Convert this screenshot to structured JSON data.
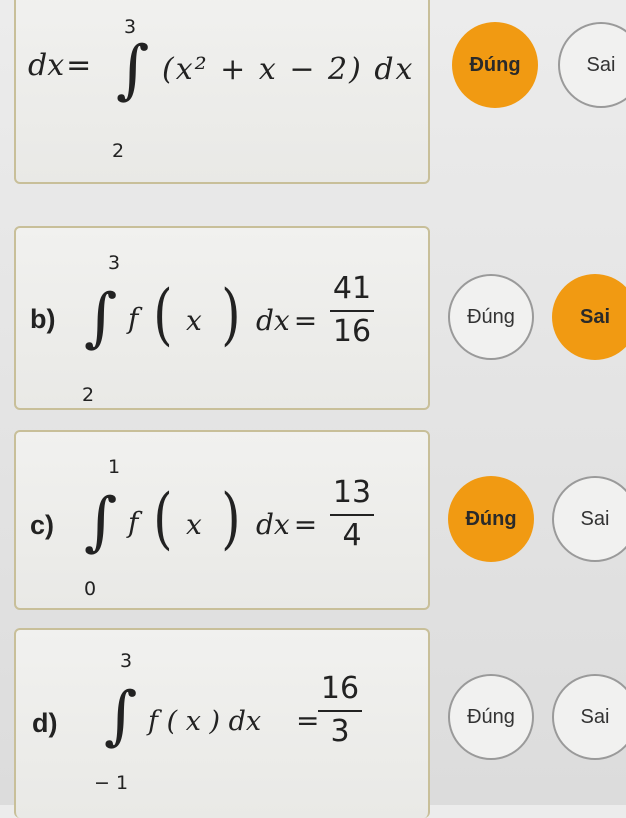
{
  "questions": [
    {
      "id": "a",
      "label": "",
      "lower": "2",
      "upper": "3",
      "lhs": "dx",
      "eq": "=",
      "integrand": "(x² + x − 2) dx",
      "choices": {
        "true_label": "Đúng",
        "false_label": "Sai",
        "selected": "true"
      }
    },
    {
      "id": "b",
      "label": "b)",
      "lower": "2",
      "upper": "3",
      "f": "f",
      "x": "x",
      "dx": "dx",
      "eq": "=",
      "numerator": "41",
      "denominator": "16",
      "choices": {
        "true_label": "Đúng",
        "false_label": "Sai",
        "selected": "false"
      }
    },
    {
      "id": "c",
      "label": "c)",
      "lower": "0",
      "upper": "1",
      "f": "f",
      "x": "x",
      "dx": "dx",
      "eq": "=",
      "numerator": "13",
      "denominator": "4",
      "choices": {
        "true_label": "Đúng",
        "false_label": "Sai",
        "selected": "true"
      }
    },
    {
      "id": "d",
      "label": "d)",
      "lower": "− 1",
      "upper": "3",
      "integrand": "f ( x ) dx",
      "eq": "=",
      "numerator": "16",
      "denominator": "3",
      "choices": {
        "true_label": "Đúng",
        "false_label": "Sai",
        "selected": "none"
      }
    }
  ],
  "colors": {
    "selected": "#f19a12",
    "card_border": "#c8bf99",
    "button_border": "#9a9a9a"
  }
}
